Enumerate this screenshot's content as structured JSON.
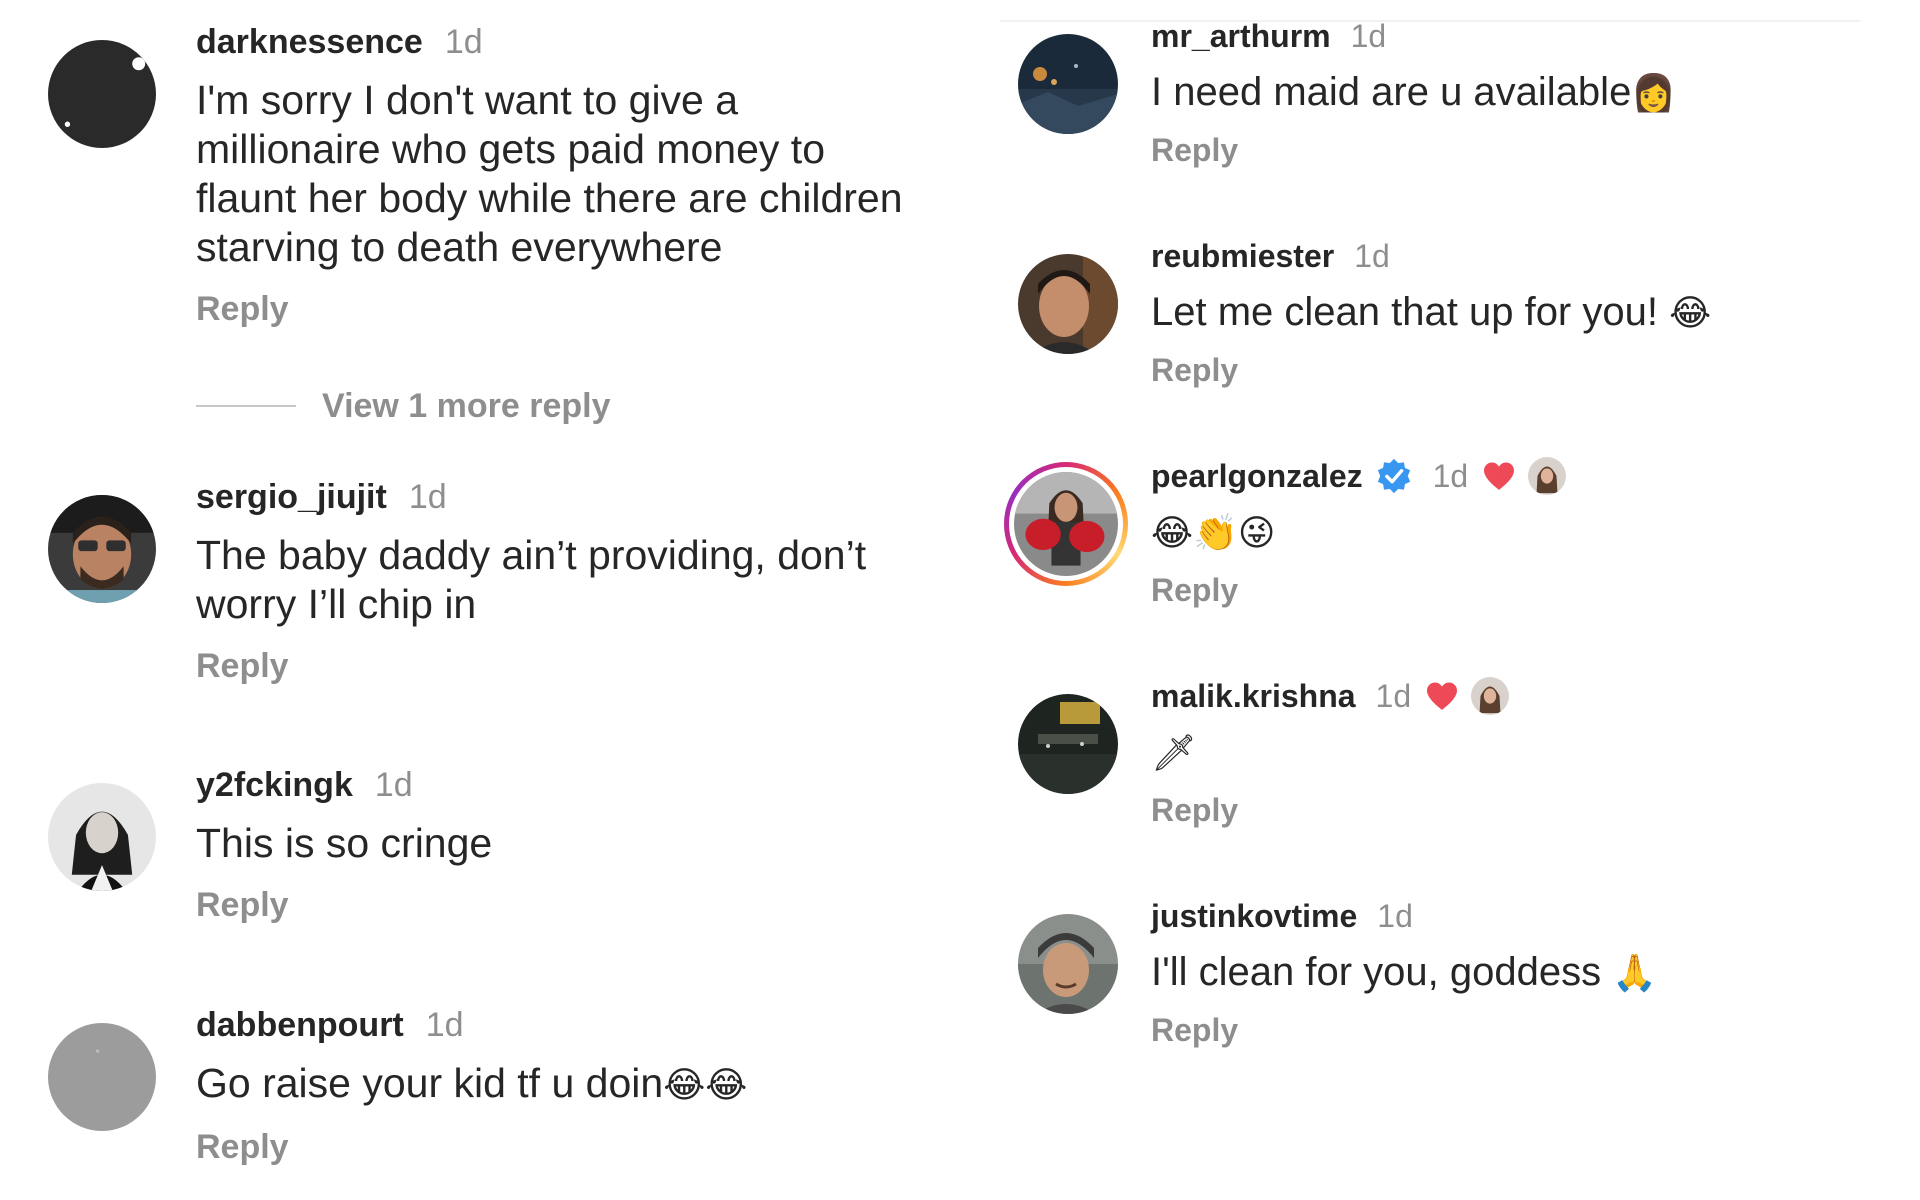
{
  "left_column": [
    {
      "username": "darknessence",
      "time": "1d",
      "text": "I'm sorry I don't want to give a\nmillionaire who gets paid money to\nflaunt her body while there are children\nstarving to death everywhere",
      "reply_label": "Reply"
    },
    {
      "username": "sergio_jiujit",
      "time": "1d",
      "text": "The baby daddy ain’t providing, don’t\nworry I’ll chip in",
      "reply_label": "Reply"
    },
    {
      "username": "y2fckingk",
      "time": "1d",
      "text": "This is so cringe",
      "reply_label": "Reply"
    },
    {
      "username": "dabbenpourt",
      "time": "1d",
      "text": "Go raise your kid tf u doin",
      "emoji": "😂😂",
      "reply_label": "Reply"
    }
  ],
  "view_replies_label": "View 1 more reply",
  "right_column": [
    {
      "username": "mr_arthurm",
      "time": "1d",
      "text": "I need maid are u available",
      "emoji": "👩",
      "reply_label": "Reply"
    },
    {
      "username": "reubmiester",
      "time": "1d",
      "text": "Let me clean that up for you! ",
      "emoji": "😂",
      "reply_label": "Reply"
    },
    {
      "username": "pearlgonzalez",
      "time": "1d",
      "text": "",
      "emoji": "😂👏😜",
      "reply_label": "Reply",
      "verified": true,
      "liked_by_author": true
    },
    {
      "username": "malik.krishna",
      "time": "1d",
      "text": "",
      "emoji": "🗡",
      "reply_label": "Reply",
      "liked_by_author": true
    },
    {
      "username": "justinkovtime",
      "time": "1d",
      "text": "I'll clean for you, goddess ",
      "emoji": "🙏",
      "reply_label": "Reply"
    }
  ],
  "colors": {
    "username": "#262626",
    "meta": "#8e8e8e",
    "heart": "#ed4956",
    "verified": "#3897f0"
  },
  "icons": {
    "verified": "verified-badge-icon",
    "heart": "heart-icon"
  }
}
